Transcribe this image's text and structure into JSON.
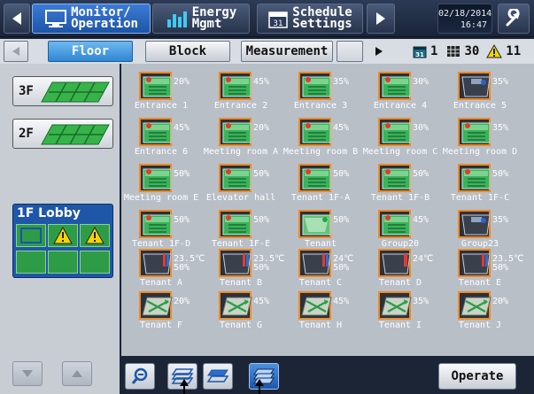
{
  "header": {
    "monitor_label": "Monitor/\nOperation",
    "energy_label": "Energy\nMgmt",
    "schedule_label": "Schedule\nSettings",
    "date": "02/18/2014",
    "time": "16:47"
  },
  "tabs": {
    "floor": "Floor",
    "block": "Block",
    "measurement": "Measurement"
  },
  "counts": {
    "schedule_count": "1",
    "grid_count": "30",
    "warning_count": "11"
  },
  "floors": [
    {
      "label": "3F"
    },
    {
      "label": "2F"
    },
    {
      "label": "1F Lobby"
    }
  ],
  "units": [
    {
      "name": "Entrance 1",
      "value": "20%",
      "icon": "fan-coil-icon"
    },
    {
      "name": "Entrance 2",
      "value": "45%",
      "icon": "fan-coil-icon"
    },
    {
      "name": "Entrance 3",
      "value": "35%",
      "icon": "fan-coil-icon"
    },
    {
      "name": "Entrance 4",
      "value": "30%",
      "icon": "fan-coil-icon"
    },
    {
      "name": "Entrance 5",
      "value": "35%",
      "icon": "air-cleaner-icon"
    },
    {
      "name": "Entrance 6",
      "value": "45%",
      "icon": "fan-coil-icon"
    },
    {
      "name": "Meeting room A",
      "value": "20%",
      "icon": "fan-coil-icon"
    },
    {
      "name": "Meeting room B",
      "value": "45%",
      "icon": "fan-coil-icon"
    },
    {
      "name": "Meeting room C",
      "value": "30%",
      "icon": "fan-coil-icon"
    },
    {
      "name": "Meeting room D",
      "value": "35%",
      "icon": "fan-coil-icon"
    },
    {
      "name": "Meeting room E",
      "value": "50%",
      "icon": "fan-coil-icon"
    },
    {
      "name": "Elevator hall",
      "value": "50%",
      "icon": "fan-coil-icon"
    },
    {
      "name": "Tenant 1F-A",
      "value": "50%",
      "icon": "fan-coil-icon"
    },
    {
      "name": "Tenant 1F-B",
      "value": "50%",
      "icon": "fan-coil-icon"
    },
    {
      "name": "Tenant 1F-C",
      "value": "50%",
      "icon": "fan-coil-icon"
    },
    {
      "name": "Tenant 1F-D",
      "value": "50%",
      "icon": "fan-coil-icon"
    },
    {
      "name": "Tenant 1F-E",
      "value": "50%",
      "icon": "fan-coil-icon"
    },
    {
      "name": "Tenant",
      "value": "50%",
      "icon": "humidifier-icon"
    },
    {
      "name": "Group20",
      "value": "45%",
      "icon": "fan-coil-icon"
    },
    {
      "name": "Group23",
      "value": "35%",
      "icon": "air-cleaner-icon"
    },
    {
      "name": "Tenant A",
      "value": "23.5℃\n50%",
      "icon": "thermo-hygro-icon"
    },
    {
      "name": "Tenant B",
      "value": "23.5℃\n50%",
      "icon": "thermo-hygro-icon"
    },
    {
      "name": "Tenant C",
      "value": "24℃\n50%",
      "icon": "thermo-hygro-icon"
    },
    {
      "name": "Tenant D",
      "value": "24℃",
      "icon": "thermometer-icon"
    },
    {
      "name": "Tenant E",
      "value": "23.5℃\n50%",
      "icon": "thermo-hygro-icon"
    },
    {
      "name": "Tenant F",
      "value": "20%",
      "icon": "ventilation-icon"
    },
    {
      "name": "Tenant G",
      "value": "45%",
      "icon": "ventilation-icon"
    },
    {
      "name": "Tenant H",
      "value": "45%",
      "icon": "ventilation-icon"
    },
    {
      "name": "Tenant I",
      "value": "35%",
      "icon": "ventilation-icon"
    },
    {
      "name": "Tenant J",
      "value": "20%",
      "icon": "ventilation-icon"
    }
  ],
  "footer": {
    "operate_label": "Operate"
  },
  "colors": {
    "accent_blue": "#2f86d2",
    "unit_border": "#f08a1e",
    "floor_green": "#2e9c47",
    "warning_yellow": "#f5d400"
  }
}
